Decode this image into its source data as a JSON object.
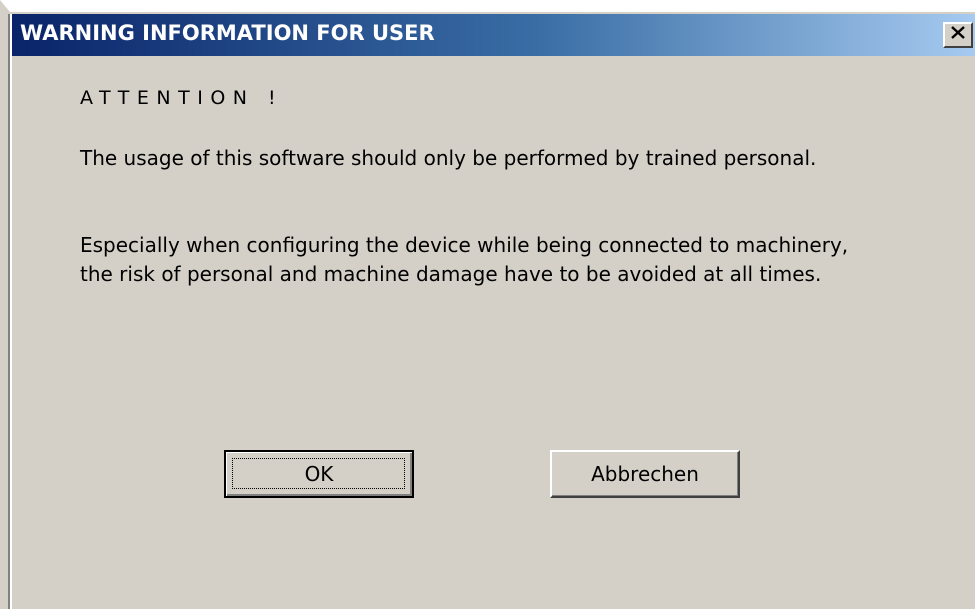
{
  "window": {
    "title": "WARNING INFORMATION FOR USER",
    "colors": {
      "titlebar_start": "#0a246a",
      "titlebar_end": "#a6caf0",
      "face": "#d4d0c8"
    }
  },
  "message": {
    "heading": "ATTENTION !",
    "paragraph1": "The usage of this software should only be performed by trained personal.",
    "paragraph2": "Especially when configuring the device while being connected to machinery, the risk of personal and machine damage have to be avoided at all times."
  },
  "buttons": {
    "ok_label": "OK",
    "cancel_label": "Abbrechen"
  },
  "icons": {
    "close": "close-icon"
  }
}
